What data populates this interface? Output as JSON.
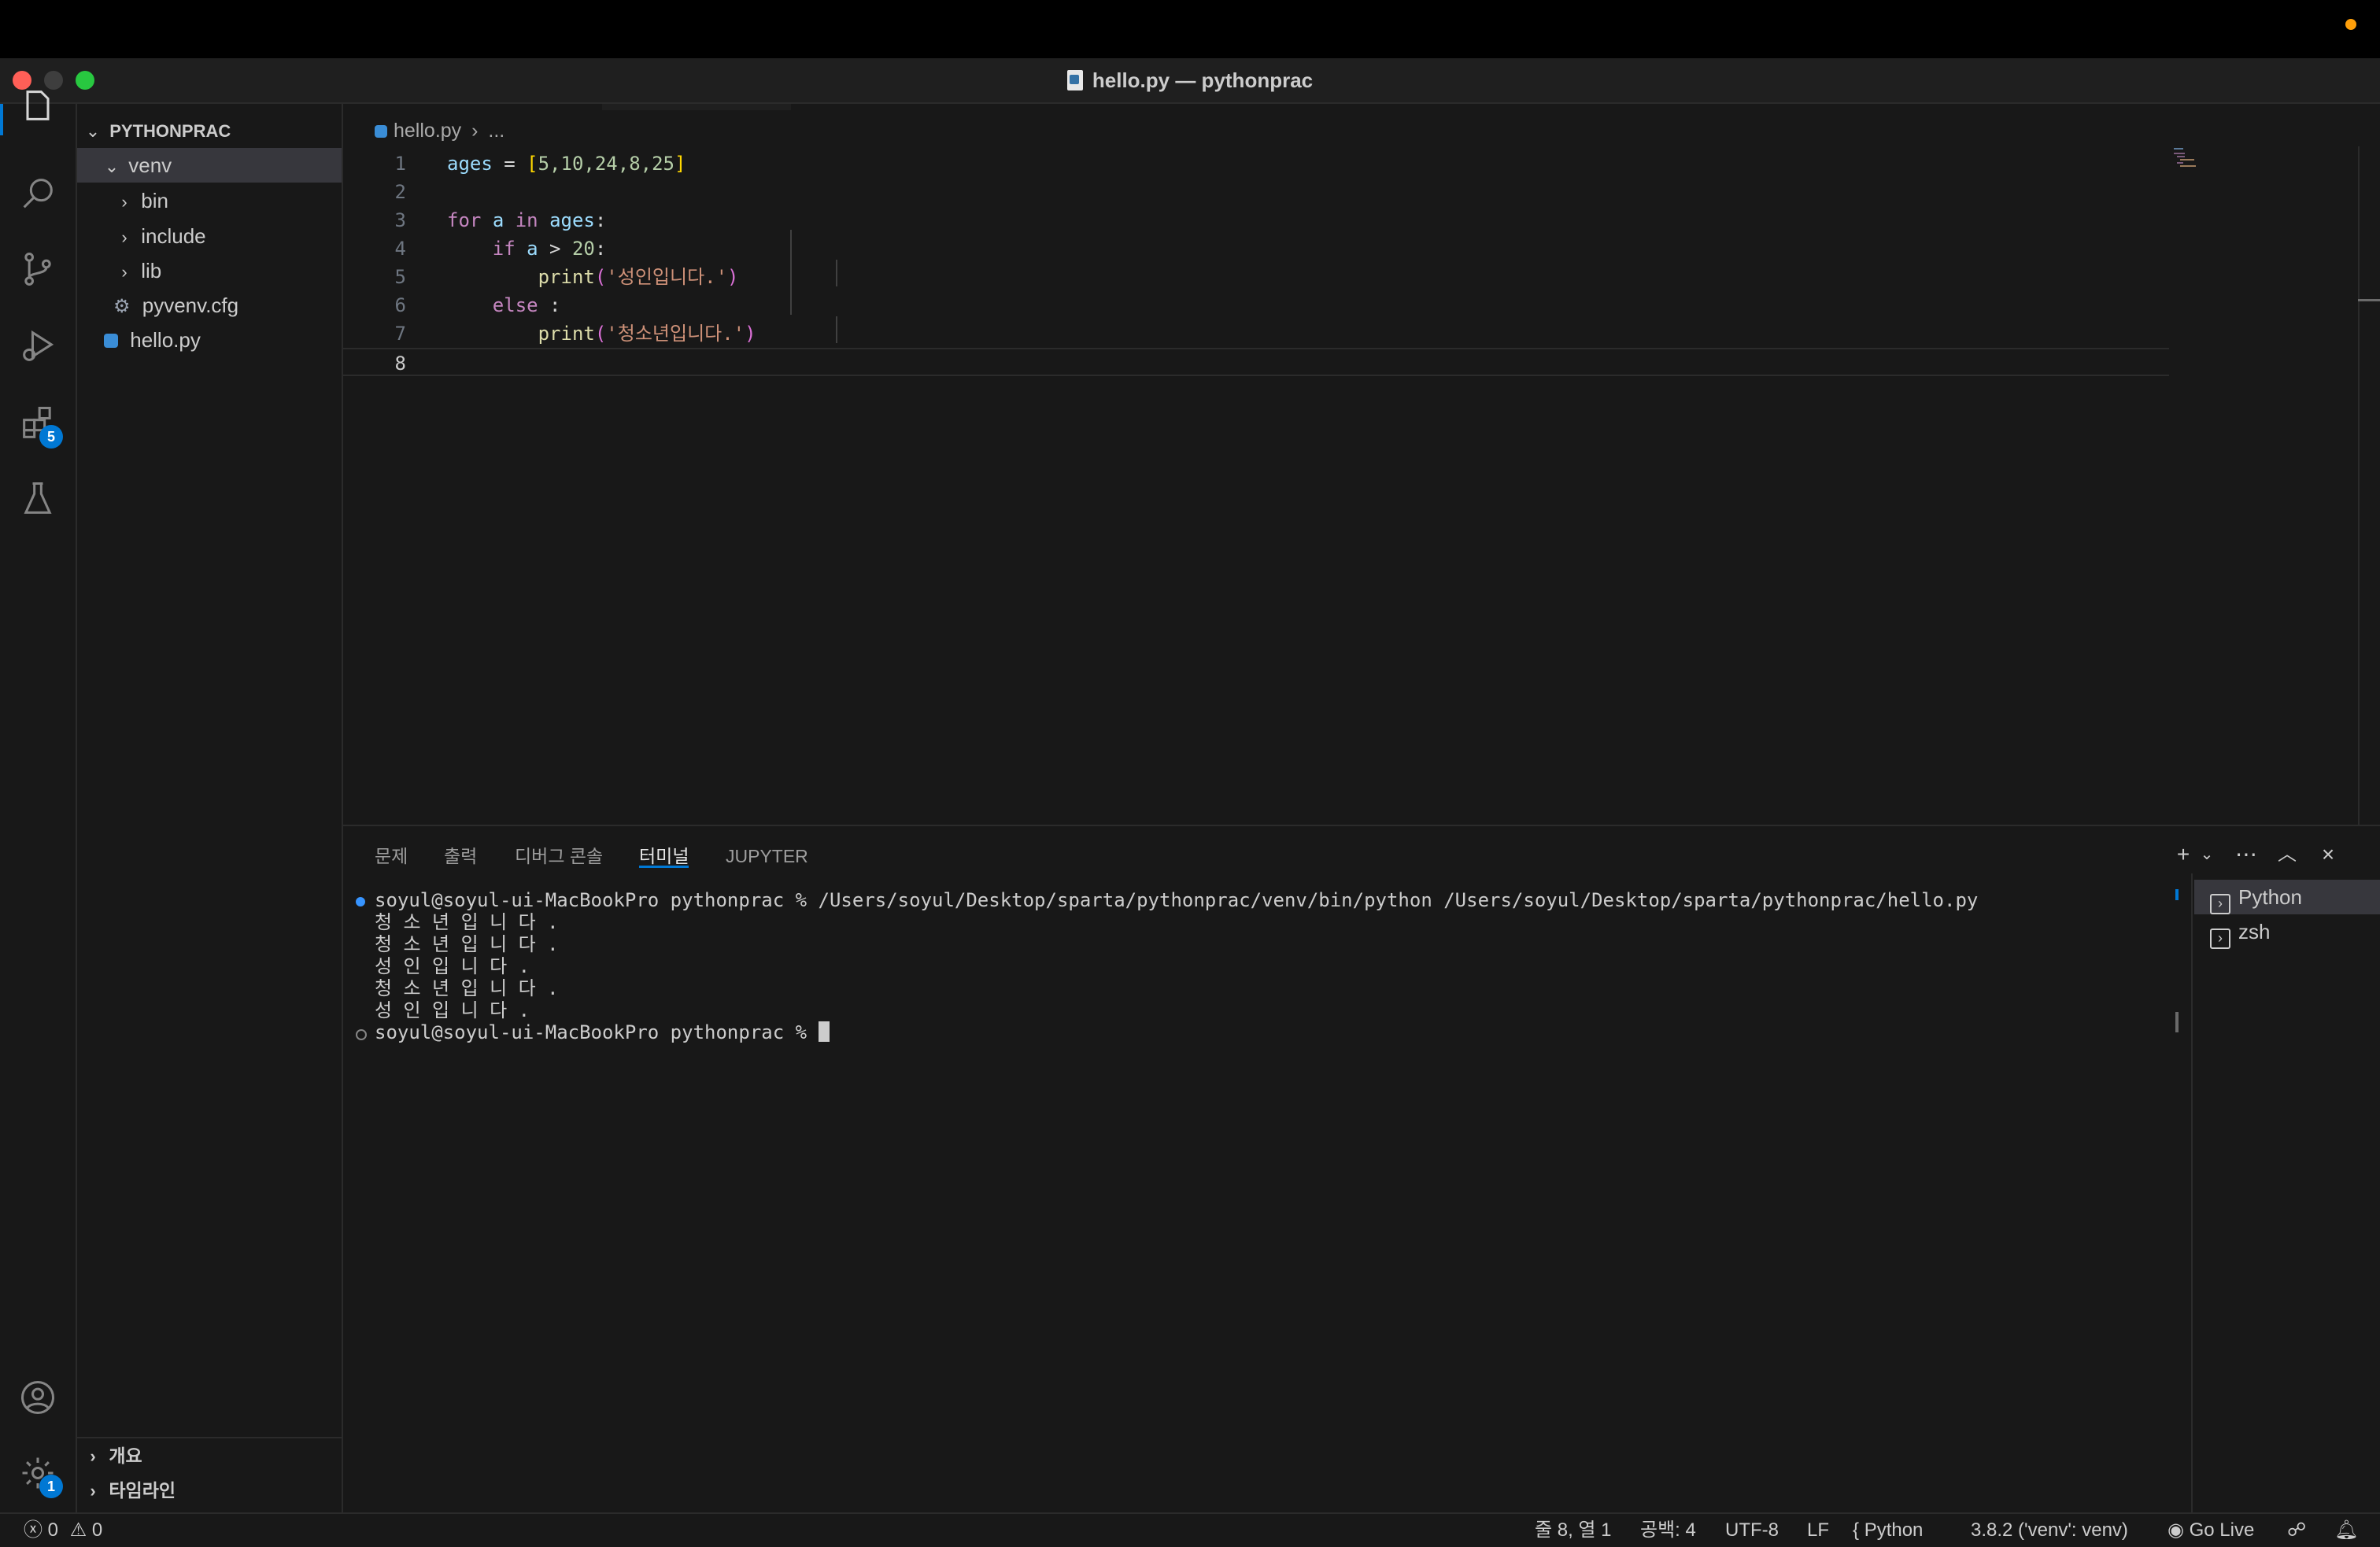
{
  "window": {
    "title": "hello.py — pythonprac"
  },
  "activity_bar": {
    "extensions_badge": "5",
    "settings_badge": "1"
  },
  "explorer": {
    "section_title": "PYTHONPRAC",
    "items": [
      {
        "label": "venv",
        "type": "folder",
        "expanded": true
      },
      {
        "label": "bin",
        "type": "folder",
        "expanded": false
      },
      {
        "label": "include",
        "type": "folder",
        "expanded": false
      },
      {
        "label": "lib",
        "type": "folder",
        "expanded": false
      },
      {
        "label": "pyvenv.cfg",
        "type": "file"
      },
      {
        "label": "hello.py",
        "type": "file"
      }
    ],
    "bottom_sections": [
      "개요",
      "타임라인"
    ]
  },
  "editor": {
    "breadcrumb": {
      "file": "hello.py",
      "rest": "..."
    },
    "line_numbers": [
      "1",
      "2",
      "3",
      "4",
      "5",
      "6",
      "7",
      "8"
    ],
    "code": {
      "l1": {
        "var": "ages",
        "eq": " = ",
        "open": "[",
        "values": "5,10,24,8,25",
        "close": "]"
      },
      "l3": {
        "kw_for": "for",
        "var_a": "a",
        "kw_in": "in",
        "var_ages": "ages",
        "colon": ":"
      },
      "l4": {
        "kw_if": "if",
        "var_a": "a",
        "op": " > ",
        "num": "20",
        "colon": ":"
      },
      "l5": {
        "fn": "print",
        "open": "(",
        "str": "'성인입니다.'",
        "close": ")"
      },
      "l6": {
        "kw_else": "else",
        "colon": " :"
      },
      "l7": {
        "fn": "print",
        "open": "(",
        "str": "'청소년입니다.'",
        "close": ")"
      }
    }
  },
  "panel": {
    "tabs": [
      "문제",
      "출력",
      "디버그 콘솔",
      "터미널",
      "JUPYTER"
    ],
    "active_tab": "터미널",
    "terminal_lines": [
      "soyul@soyul-ui-MacBookPro pythonprac % /Users/soyul/Desktop/sparta/pythonprac/venv/bin/python /Users/soyul/Desktop/sparta/pythonprac/hello.py",
      "청 소 년 입 니 다 .",
      "청 소 년 입 니 다 .",
      "성 인 입 니 다 .",
      "청 소 년 입 니 다 .",
      "성 인 입 니 다 .",
      "soyul@soyul-ui-MacBookPro pythonprac % "
    ],
    "terminals": [
      "Python",
      "zsh"
    ]
  },
  "status_bar": {
    "errors": "0",
    "warnings": "0",
    "position": "줄 8, 열 1",
    "spaces": "공백: 4",
    "encoding": "UTF-8",
    "eol": "LF",
    "language": "Python",
    "interpreter": "3.8.2 ('venv': venv)",
    "go_live": "Go Live"
  },
  "colors": {
    "accent": "#0078d4",
    "background": "#181818",
    "keyword": "#c586c0",
    "string": "#ce9178",
    "function": "#dcdcaa",
    "variable": "#9cdcfe"
  }
}
